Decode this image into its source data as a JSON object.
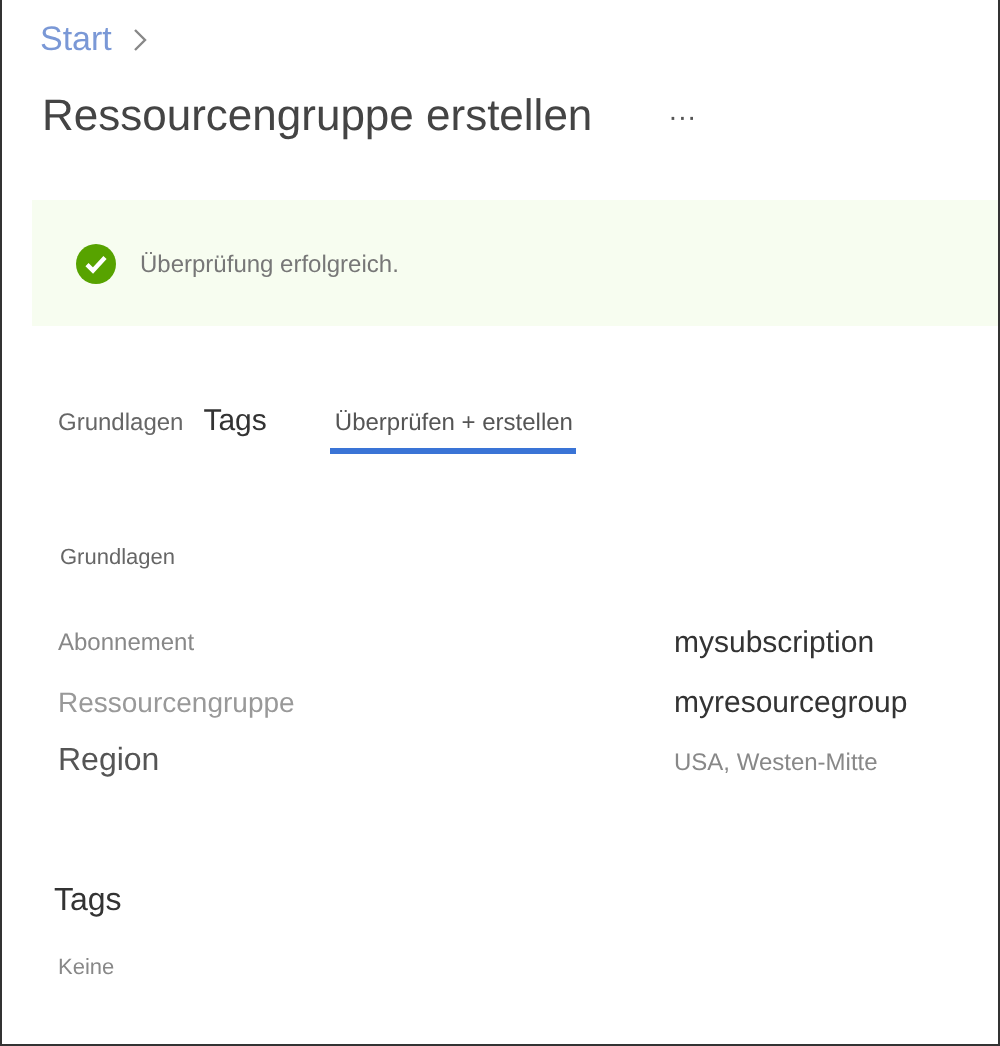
{
  "breadcrumb": [
    {
      "label": "Start"
    }
  ],
  "title": "Ressourcengruppe erstellen",
  "more": "···",
  "banner": {
    "kind": "success",
    "message": "Überprüfung erfolgreich."
  },
  "tabs": [
    {
      "label": "Grundlagen",
      "selected": false
    },
    {
      "label": "Tags",
      "selected": false
    },
    {
      "label": "Überprüfen + erstellen",
      "selected": true
    }
  ],
  "basics": {
    "heading": "Grundlagen",
    "rows": [
      {
        "label": "Abonnement",
        "value": "mysubscription"
      },
      {
        "label": "Ressourcengruppe",
        "value": "myresourcegroup"
      },
      {
        "label": "Region",
        "value": "USA, Westen-Mitte"
      }
    ]
  },
  "tags": {
    "heading": "Tags",
    "value": "Keine"
  }
}
